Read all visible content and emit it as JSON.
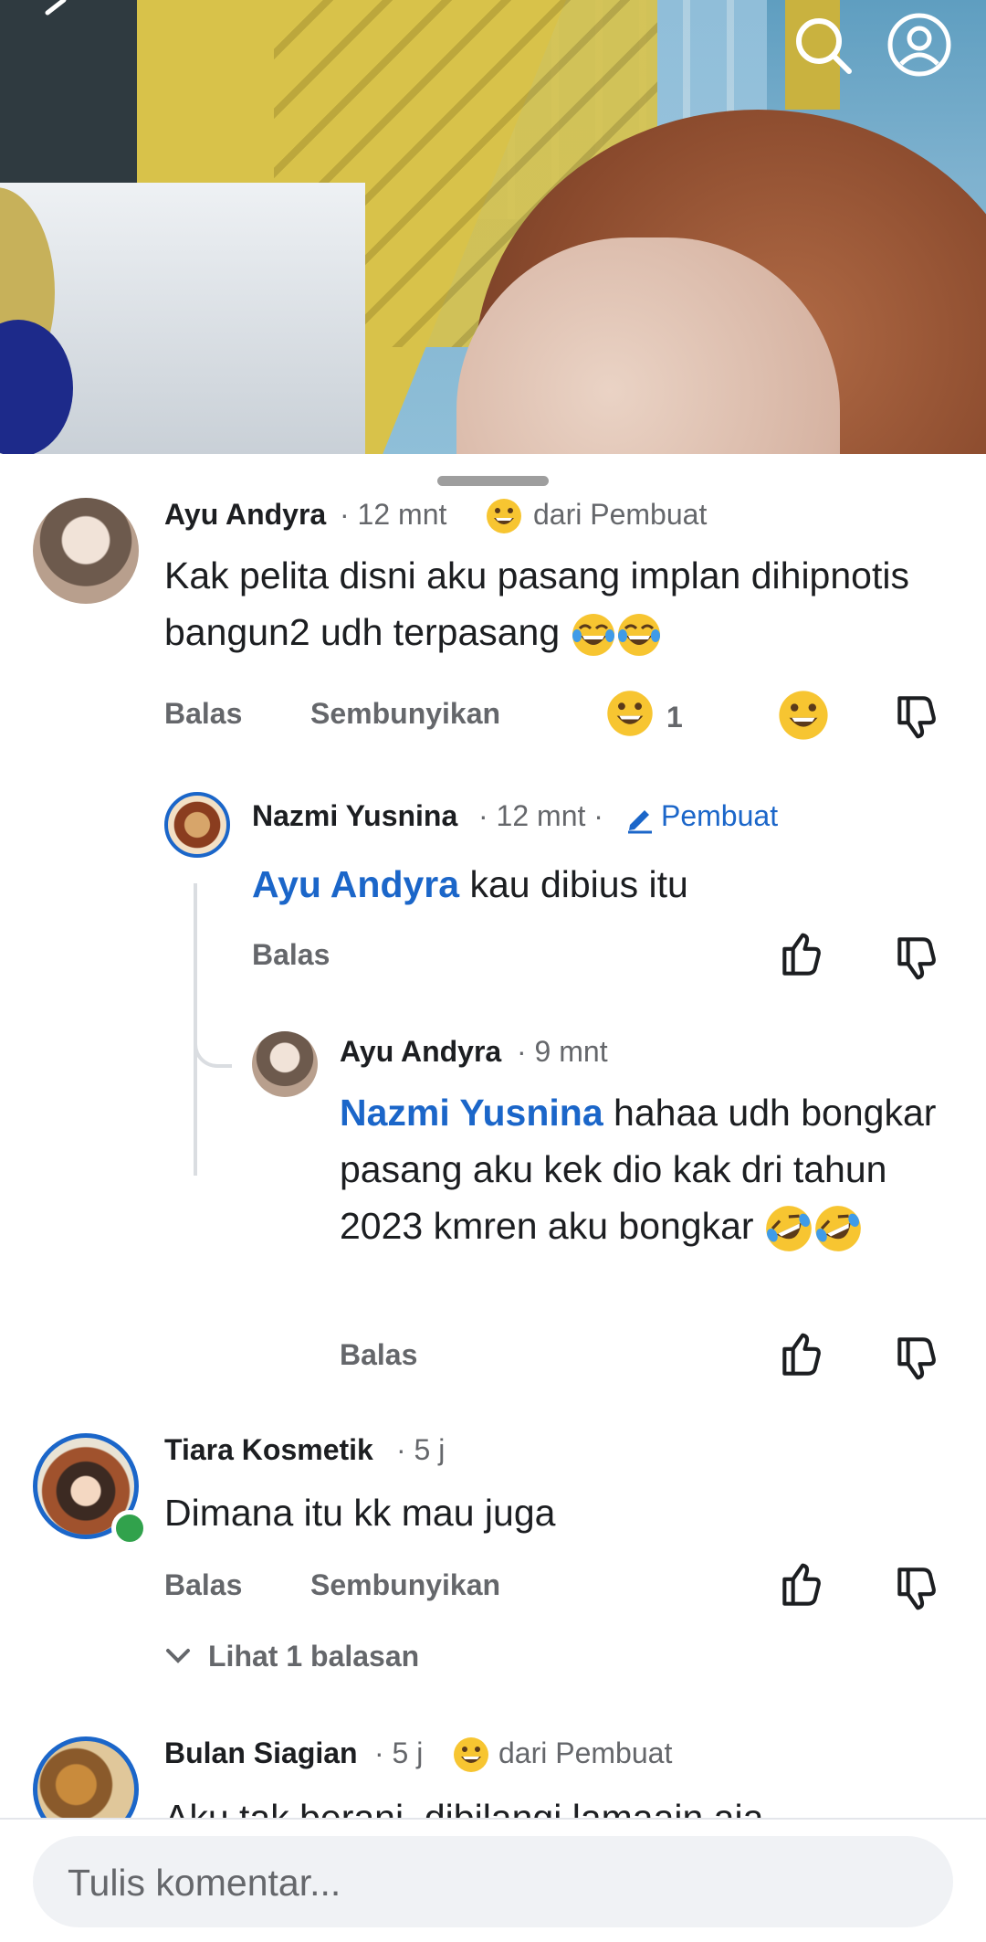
{
  "video": {
    "search_icon": "search-icon",
    "profile_icon": "profile-icon"
  },
  "comments": [
    {
      "author": "Ayu Andyra",
      "time": "· 12 mnt",
      "badge": "dari Pembuat",
      "text": "Kak pelita disni aku pasang implan dihipnotis bangun2 udh terpasang",
      "reply_label": "Balas",
      "hide_label": "Sembunyikan",
      "reaction_count": "1"
    },
    {
      "author": "Nazmi Yusnina",
      "time": "· 12 mnt ·",
      "creator_label": "Pembuat",
      "mention": "Ayu Andyra",
      "text": "kau dibius itu",
      "reply_label": "Balas"
    },
    {
      "author": "Ayu Andyra",
      "time": "· 9 mnt",
      "mention": "Nazmi Yusnina",
      "text": "hahaa udh bongkar pasang aku kek dio kak dri tahun 2023 kmren aku bongkar",
      "reply_label": "Balas"
    },
    {
      "author": "Tiara Kosmetik",
      "time": "· 5 j",
      "text": "Dimana itu kk mau juga",
      "reply_label": "Balas",
      "hide_label": "Sembunyikan",
      "view_replies": "Lihat 1 balasan"
    },
    {
      "author": "Bulan Siagian",
      "time": "· 5 j",
      "badge": "dari Pembuat",
      "text": "Aku tak berani, dibilangi lamaain aja"
    }
  ],
  "composer": {
    "placeholder": "Tulis komentar..."
  },
  "colors": {
    "mention": "#1b66c9",
    "meta": "#65676b",
    "online": "#31a24c"
  }
}
